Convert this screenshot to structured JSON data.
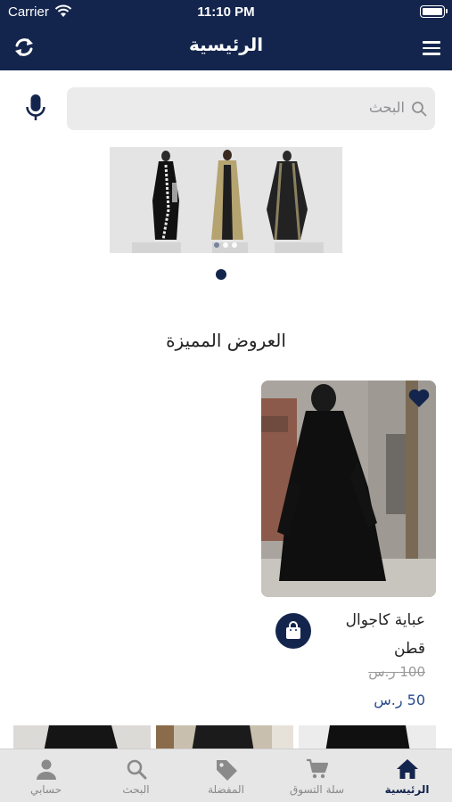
{
  "status_bar": {
    "carrier": "Carrier",
    "time": "11:10 PM"
  },
  "header": {
    "title": "الرئيسية",
    "refresh_icon": "refresh-icon",
    "menu_icon": "hamburger-menu-icon"
  },
  "search": {
    "placeholder": "البحث",
    "mic_icon": "microphone-icon",
    "search_icon": "search-icon"
  },
  "banner": {
    "slide_count": 1,
    "active_slide": 1
  },
  "featured": {
    "title": "العروض المميزة",
    "products": [
      {
        "name_line1": "عباية كاجوال",
        "name_line2": "قطن",
        "old_price": "100 ر.س",
        "new_price": "50 ر.س"
      }
    ]
  },
  "tabbar": {
    "items": [
      {
        "label": "الرئيسية",
        "icon": "home-icon",
        "active": true
      },
      {
        "label": "سلة التسوق",
        "icon": "cart-icon",
        "active": false
      },
      {
        "label": "المفضلة",
        "icon": "tag-icon",
        "active": false
      },
      {
        "label": "البحث",
        "icon": "search-icon",
        "active": false
      },
      {
        "label": "حسابي",
        "icon": "person-icon",
        "active": false
      }
    ]
  },
  "colors": {
    "brand": "#14254d",
    "price": "#2a4a8c"
  }
}
